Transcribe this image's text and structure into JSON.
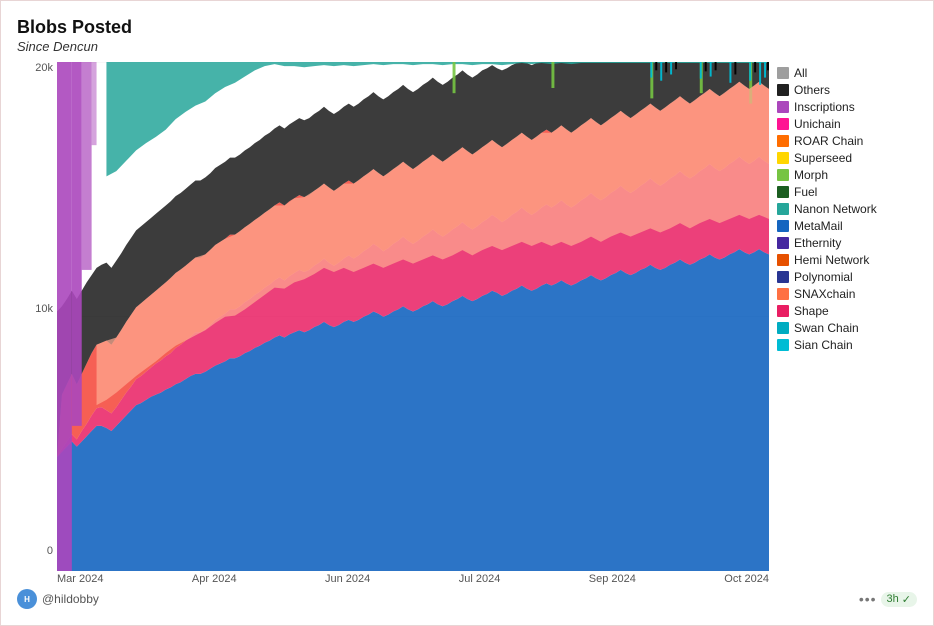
{
  "header": {
    "title": "Blobs Posted",
    "subtitle": "Since Dencun"
  },
  "yAxis": {
    "labels": [
      "20k",
      "10k",
      "0"
    ]
  },
  "xAxis": {
    "labels": [
      "Mar 2024",
      "Apr 2024",
      "Jun 2024",
      "Jul 2024",
      "Sep 2024",
      "Oct 2024"
    ]
  },
  "legend": [
    {
      "label": "All",
      "color": "#9e9e9e"
    },
    {
      "label": "Others",
      "color": "#212121"
    },
    {
      "label": "Inscriptions",
      "color": "#ab47bc"
    },
    {
      "label": "Unichain",
      "color": "#ff1493"
    },
    {
      "label": "ROAR Chain",
      "color": "#ff6d00"
    },
    {
      "label": "Superseed",
      "color": "#ffd600"
    },
    {
      "label": "Morph",
      "color": "#76c442"
    },
    {
      "label": "Fuel",
      "color": "#1b5e20"
    },
    {
      "label": "Nanon Network",
      "color": "#26a69a"
    },
    {
      "label": "MetaMail",
      "color": "#1565c0"
    },
    {
      "label": "Ethernity",
      "color": "#4527a0"
    },
    {
      "label": "Hemi Network",
      "color": "#e65100"
    },
    {
      "label": "Polynomial",
      "color": "#283593"
    },
    {
      "label": "SNAXchain",
      "color": "#ff7043"
    },
    {
      "label": "Shape",
      "color": "#e91e63"
    },
    {
      "label": "Swan Chain",
      "color": "#00acc1"
    },
    {
      "label": "Sian Chain",
      "color": "#00bcd4"
    }
  ],
  "footer": {
    "handle": "@hildobby",
    "time": "3h",
    "time_icon": "✓"
  },
  "colors": {
    "blue": "#1565c0",
    "magenta": "#e91e63",
    "red": "#f44336",
    "yellow": "#ffd600",
    "dark": "#212121",
    "teal": "#26a69a",
    "orange": "#ff6d00",
    "green": "#76c442",
    "purple": "#ab47bc",
    "cyan": "#00bcd4",
    "peach": "#ffab91"
  }
}
